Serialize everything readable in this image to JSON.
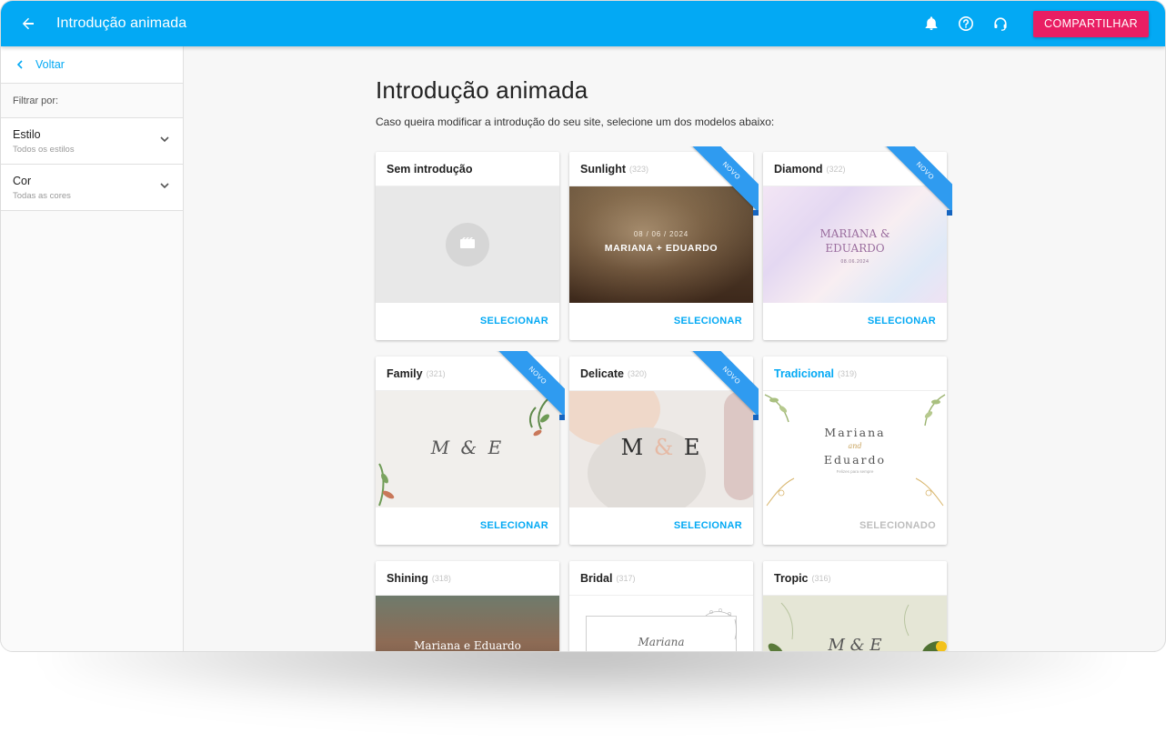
{
  "header": {
    "title": "Introdução animada",
    "share_label": "COMPARTILHAR"
  },
  "sidebar": {
    "back_label": "Voltar",
    "filter_label": "Filtrar por:",
    "filters": [
      {
        "title": "Estilo",
        "value": "Todos os estilos"
      },
      {
        "title": "Cor",
        "value": "Todas as cores"
      }
    ]
  },
  "main": {
    "title": "Introdução animada",
    "description": "Caso queira modificar a introdução do seu site, selecione um dos modelos abaixo:",
    "badge_label": "NOVO",
    "cards": [
      {
        "title": "Sem introdução",
        "count": "",
        "action": "SELECIONAR",
        "new": false
      },
      {
        "title": "Sunlight",
        "count": "(323)",
        "action": "SELECIONAR",
        "new": true,
        "preview_date": "08 / 06 / 2024",
        "preview_names": "MARIANA + EDUARDO"
      },
      {
        "title": "Diamond",
        "count": "(322)",
        "action": "SELECIONAR",
        "new": true,
        "preview_names_1": "MARIANA &",
        "preview_names_2": "EDUARDO",
        "preview_date": "08.06.2024"
      },
      {
        "title": "Family",
        "count": "(321)",
        "action": "SELECIONAR",
        "new": true,
        "preview_mono": "M & E"
      },
      {
        "title": "Delicate",
        "count": "(320)",
        "action": "SELECIONAR",
        "new": true,
        "preview_m": "M",
        "preview_amp": "&",
        "preview_e": "E"
      },
      {
        "title": "Tradicional",
        "count": "(319)",
        "action": "SELECIONADO",
        "new": false,
        "selected": true,
        "preview_name_1": "Mariana",
        "preview_and": "and",
        "preview_name_2": "Eduardo",
        "preview_sub": "Felizes para sempre"
      },
      {
        "title": "Shining",
        "count": "(318)",
        "action": "SELECIONAR",
        "new": false,
        "preview_names": "Mariana e Eduardo"
      },
      {
        "title": "Bridal",
        "count": "(317)",
        "action": "SELECIONAR",
        "new": false,
        "preview_names": "Mariana"
      },
      {
        "title": "Tropic",
        "count": "(316)",
        "action": "SELECIONAR",
        "new": false,
        "preview_names": "M & E"
      }
    ]
  },
  "colors": {
    "primary": "#03a9f4",
    "accent": "#e91e63",
    "ribbon": "#2f9bf0"
  },
  "icons": [
    "back-arrow-icon",
    "bell-icon",
    "help-icon",
    "support-icon",
    "chevron-left-icon",
    "chevron-down-icon",
    "video-icon"
  ]
}
